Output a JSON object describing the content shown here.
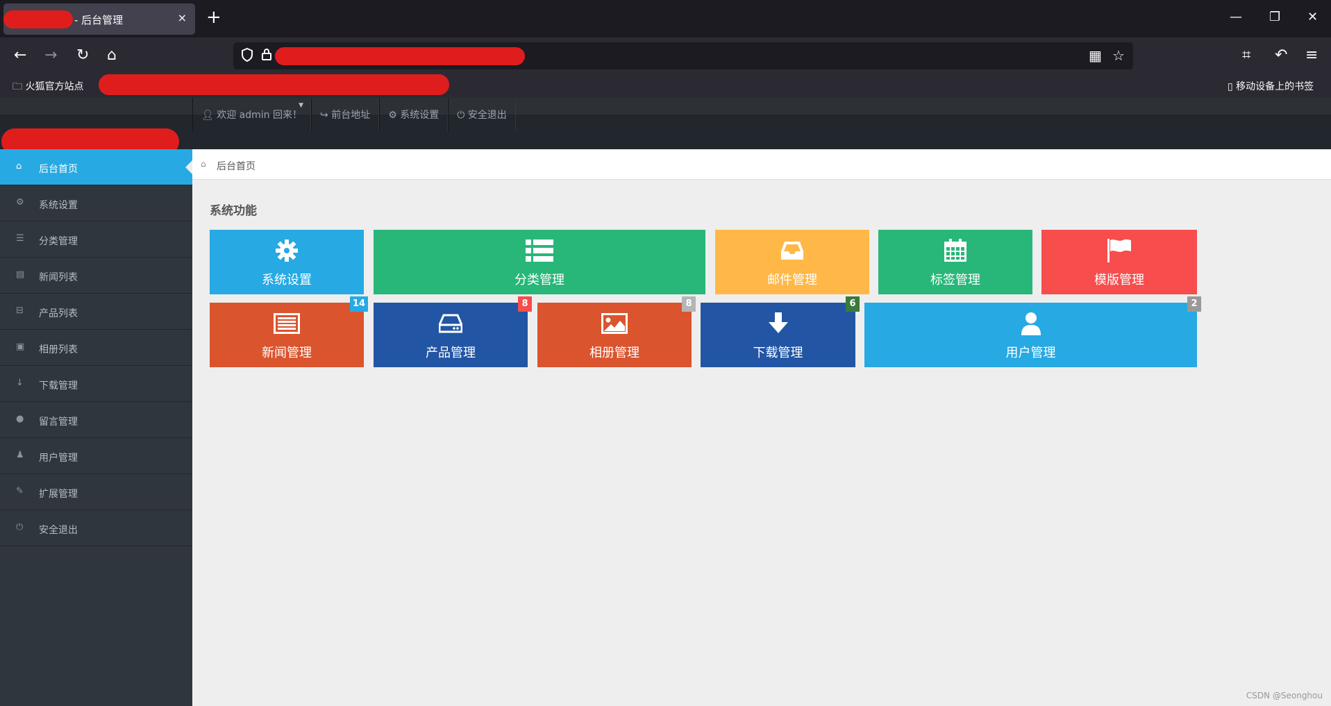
{
  "browser": {
    "tab_title": "- 后台管理",
    "tab_close": "×",
    "new_tab": "+",
    "window_controls": {
      "minimize": "—",
      "restore": "❐",
      "close": "✕"
    },
    "nav": {
      "back": "←",
      "forward": "→",
      "reload": "↻",
      "home": "⌂"
    },
    "urlbar_right_icons": {
      "qr": "▦",
      "star": "☆"
    },
    "toolbar_right": {
      "crop": "⌗",
      "undo": "↶",
      "menu": "≡"
    },
    "bookmarks": [
      {
        "label": "火狐官方站点"
      }
    ],
    "mobile_bookmarks": "移动设备上的书签"
  },
  "app": {
    "topmenu": [
      {
        "icon": "user-icon",
        "label": "欢迎 admin 回来！"
      },
      {
        "icon": "share-icon",
        "label": "前台地址"
      },
      {
        "icon": "gear-icon",
        "label": "系统设置"
      },
      {
        "icon": "power-icon",
        "label": "安全退出"
      }
    ],
    "sidebar": [
      {
        "icon": "home-icon",
        "label": "后台首页",
        "active": true
      },
      {
        "icon": "gear-icon",
        "label": "系统设置"
      },
      {
        "icon": "list-icon",
        "label": "分类管理"
      },
      {
        "icon": "newspaper-icon",
        "label": "新闻列表"
      },
      {
        "icon": "drive-icon",
        "label": "产品列表"
      },
      {
        "icon": "picture-icon",
        "label": "相册列表"
      },
      {
        "icon": "download-icon",
        "label": "下载管理"
      },
      {
        "icon": "comment-icon",
        "label": "留言管理"
      },
      {
        "icon": "user-icon",
        "label": "用户管理"
      },
      {
        "icon": "leaf-icon",
        "label": "扩展管理"
      },
      {
        "icon": "power-icon",
        "label": "安全退出"
      }
    ],
    "breadcrumb": {
      "icon": "home-icon",
      "label": "后台首页"
    },
    "section_title": "系统功能",
    "tiles": [
      {
        "label": "系统设置",
        "icon": "gear-icon",
        "color": "#27a9e3"
      },
      {
        "label": "分类管理",
        "icon": "list-icon",
        "color": "#28b779"
      },
      {
        "label": "邮件管理",
        "icon": "inbox-icon",
        "color": "#ffb848"
      },
      {
        "label": "标签管理",
        "icon": "calendar-icon",
        "color": "#28b779"
      },
      {
        "label": "模版管理",
        "icon": "flag-icon",
        "color": "#f74d4d"
      },
      {
        "label": "新闻管理",
        "icon": "newspaper-icon",
        "color": "#da542e",
        "badge": "14",
        "badge_color": "#27a9e3"
      },
      {
        "label": "产品管理",
        "icon": "drive-icon",
        "color": "#2255a4",
        "badge": "8",
        "badge_color": "#f74d4d"
      },
      {
        "label": "相册管理",
        "icon": "picture-icon",
        "color": "#da542e",
        "badge": "8",
        "badge_color": "#b5b5b5"
      },
      {
        "label": "下载管理",
        "icon": "download-icon",
        "color": "#2255a4",
        "badge": "6",
        "badge_color": "#3a7a3a"
      },
      {
        "label": "用户管理",
        "icon": "user-icon",
        "color": "#27a9e3",
        "badge": "2",
        "badge_color": "#999999"
      }
    ]
  },
  "watermark": "CSDN @Seonghou"
}
